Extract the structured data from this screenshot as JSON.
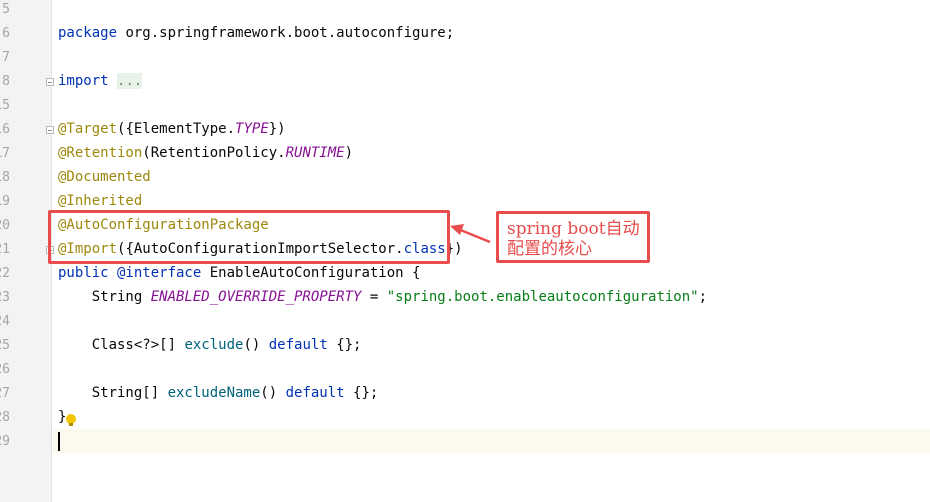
{
  "gutter": {
    "line_numbers": [
      "5",
      "6",
      "7",
      "8",
      "15",
      "16",
      "17",
      "18",
      "19",
      "20",
      "21",
      "22",
      "23",
      "24",
      "25",
      "26",
      "27",
      "28",
      "29"
    ]
  },
  "code": {
    "package_kw": "package",
    "package_name": " org.springframework.boot.autoconfigure;",
    "import_kw": "import",
    "import_fold": "...",
    "target_ann": "@Target",
    "target_open": "({ElementType.",
    "target_const": "TYPE",
    "target_close": "})",
    "retention_ann": "@Retention",
    "retention_open": "(RetentionPolicy.",
    "retention_const": "RUNTIME",
    "retention_close": ")",
    "documented_ann": "@Documented",
    "inherited_ann": "@Inherited",
    "autoconfigpkg_ann": "@AutoConfigurationPackage",
    "import_ann": "@Import",
    "import_ann_args_open": "({AutoConfigurationImportSelector.",
    "class_kw": "class",
    "import_ann_args_close": "})",
    "public_kw": "public",
    "interface_kw": " @interface",
    "enable_decl": " EnableAutoConfiguration {",
    "string_type": "    String ",
    "override_const": "ENABLED_OVERRIDE_PROPERTY",
    "assign": " = ",
    "override_value": "\"spring.boot.enableautoconfiguration\"",
    "semi": ";",
    "class_type": "    Class<?>[] ",
    "exclude_method": "exclude",
    "exclude_parens": "() ",
    "default_kw": "default",
    "empty_array": " {};",
    "string_array_type": "    String[] ",
    "exclude_name_method": "excludeName",
    "close_brace": "}"
  },
  "annotation": {
    "callout_text": "spring boot自动配置的核心",
    "color": "#e84c4c"
  }
}
